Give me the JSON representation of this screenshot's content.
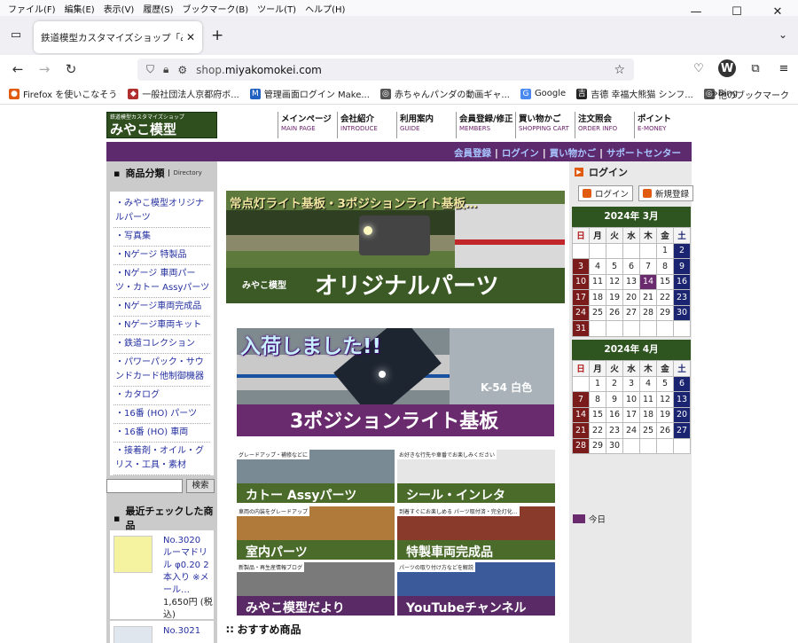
{
  "menu": [
    "ファイル(F)",
    "編集(E)",
    "表示(V)",
    "履歴(S)",
    "ブックマーク(B)",
    "ツール(T)",
    "ヘルプ(H)"
  ],
  "window": {
    "minimize": "—",
    "maximize": "☐",
    "close": "✕"
  },
  "tab": {
    "title": "鉄道模型カスタマイズショップ「みやこ模",
    "close": "✕",
    "new": "+",
    "list": "⌄"
  },
  "url": {
    "prefix": "shop.",
    "domain": "miyakomokei.com"
  },
  "bookmarks": [
    "Firefox を使いこなそう",
    "一般社団法人京都府ボ...",
    "管理画面ログイン Make...",
    "赤ちゃんパンダの動画ギャ...",
    "Google",
    "吉德 幸福大熊猫 シンフ...",
    "Bing"
  ],
  "bookmarks_more": "»",
  "bookmarks_other": "他のブックマーク",
  "site": {
    "logo_sub": "鉄道模型カスタマイズショップ",
    "logo_main": "みやこ模型",
    "nav": [
      {
        "ja": "メインページ",
        "en": "MAIN PAGE"
      },
      {
        "ja": "会社紹介",
        "en": "INTRODUCE"
      },
      {
        "ja": "利用案内",
        "en": "GUIDE"
      },
      {
        "ja": "会員登録/修正",
        "en": "MEMBERS"
      },
      {
        "ja": "買い物かご",
        "en": "SHOPPING CART"
      },
      {
        "ja": "注文照会",
        "en": "ORDER INFO"
      },
      {
        "ja": "ポイント",
        "en": "E-MONEY"
      }
    ],
    "toplinks": [
      "会員登録",
      "ログイン",
      "買い物かご",
      "サポートセンター"
    ],
    "sep": "|",
    "category_title": "商品分類",
    "category_sub": "Directory",
    "categories": [
      "・みやこ模型オリジナルパーツ",
      "・写真集",
      "・Nゲージ 特製品",
      "・Nゲージ 車両パーツ・カトー Assyパーツ",
      "・Nゲージ車両完成品",
      "・Nゲージ車両キット",
      "・鉄道コレクション",
      "・パワーパック・サウンドカード他制御機器",
      "・カタログ",
      "・16番 (HO) パーツ",
      "・16番 (HO) 車両",
      "・接着剤・オイル・グリス・工具・素材"
    ],
    "search_button": "検索",
    "recent_title": "最近チェックした商品",
    "recent": [
      {
        "title": "No.3020 ルーマドリル φ0.20 2本入り ※メール…",
        "price": "1,650円 (税込)"
      },
      {
        "title": "No.3021",
        "price": ""
      }
    ],
    "banner1": {
      "top": "常点灯ライト基板・3ポジションライト基板…",
      "small": "みやこ模型",
      "big": "オリジナルパーツ"
    },
    "banner2": {
      "top": "入荷しました!!",
      "tag": "K-54 白色",
      "big": "3ポジションライト基板"
    },
    "small_banners": [
      {
        "tag": "グレードアップ・補修などに",
        "label": "カトー Assyパーツ"
      },
      {
        "tag": "お好きな行先や車番でお楽しみください",
        "label": "シール・インレタ"
      },
      {
        "tag": "車両の内装をグレードアップ",
        "label": "室内パーツ"
      },
      {
        "tag": "到着すぐにお楽しめる パーツ取付済・完全灯化…",
        "label": "特製車両完成品"
      },
      {
        "tag": "新製品・再生産情報ブログ",
        "label": "みやこ模型だより"
      },
      {
        "tag": "パーツの取り付け方などを解説",
        "label": "YouTubeチャンネル"
      }
    ],
    "recommend": "おすすめ商品",
    "login_title": "ログイン",
    "login_button": "ログイン",
    "register_button": "新規登録",
    "cal_march": {
      "title": "2024年 3月"
    },
    "cal_april": {
      "title": "2024年 4月"
    },
    "weekdays": [
      "日",
      "月",
      "火",
      "水",
      "木",
      "金",
      "土"
    ],
    "today_label": "今日"
  },
  "colors": {
    "accent_purple": "#5e2a6e",
    "accent_green": "#2e5520",
    "sunday": "#7a1c1c",
    "saturday": "#1a2470"
  }
}
